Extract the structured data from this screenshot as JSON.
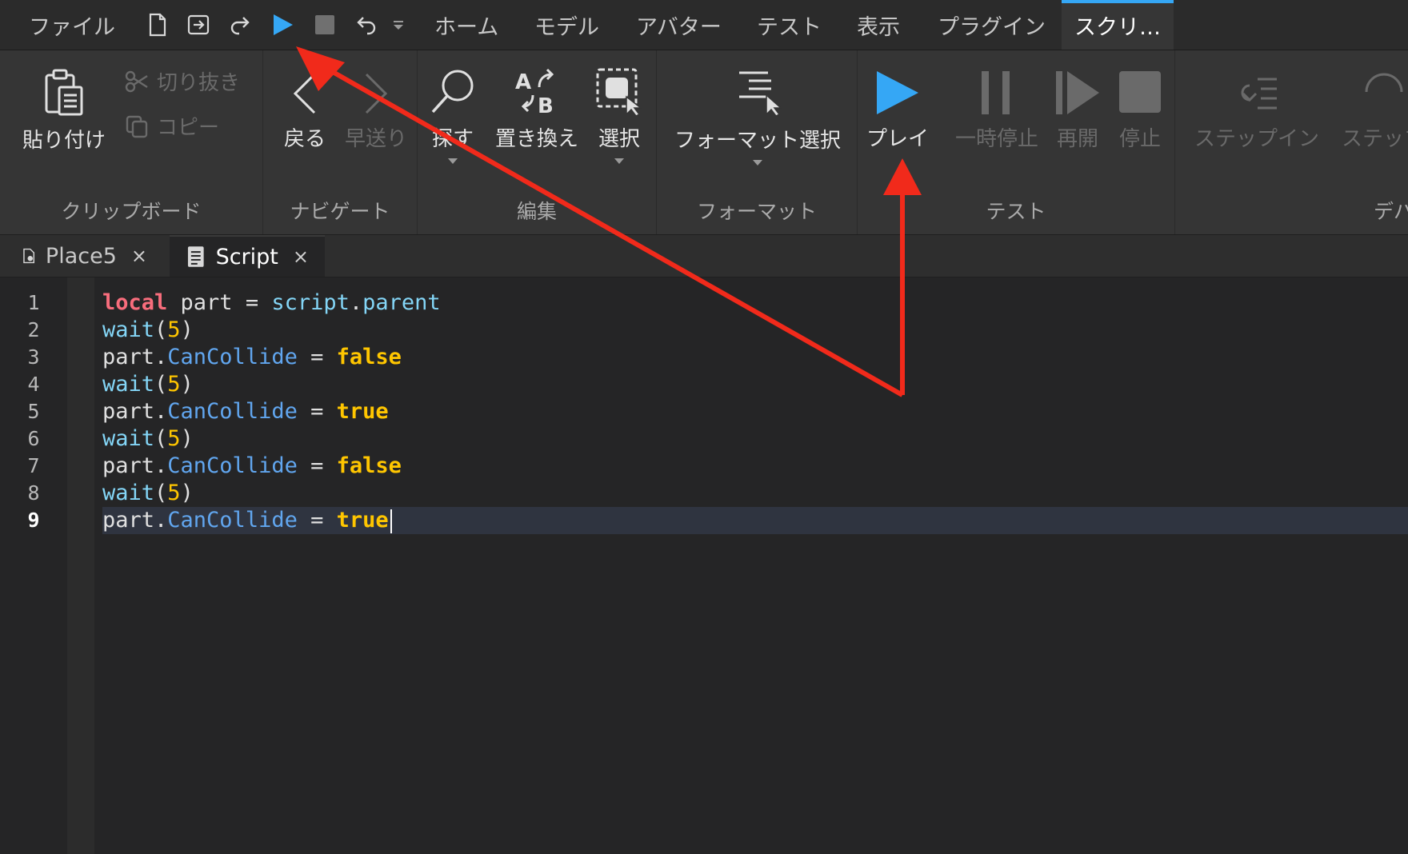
{
  "colors": {
    "accent": "#35a7f5",
    "annotation": "#f12a1b",
    "keyword": "#f86d7c",
    "builtin": "#84d6f7",
    "property": "#61a6ef",
    "literal": "#ffc600"
  },
  "menu": {
    "file": "ファイル",
    "tabs": [
      "ホーム",
      "モデル",
      "アバター",
      "テスト",
      "表示",
      "プラグイン",
      "スクリ…"
    ]
  },
  "quick_access": [
    "new-file-icon",
    "publish-icon",
    "redo-icon",
    "play-icon",
    "stop-icon",
    "undo-icon",
    "dropdown-icon"
  ],
  "ribbon": {
    "clipboard": {
      "label": "クリップボード",
      "paste": "貼り付け",
      "cut": "切り抜き",
      "copy": "コピー"
    },
    "navigate": {
      "label": "ナビゲート",
      "back": "戻る",
      "forward": "早送り"
    },
    "edit": {
      "label": "編集",
      "find": "探す",
      "replace": "置き換え",
      "select": "選択"
    },
    "format": {
      "label": "フォーマット",
      "format_selection": "フォーマット選択"
    },
    "test": {
      "label": "テスト",
      "play": "プレイ",
      "pause": "一時停止",
      "resume": "再開",
      "stop": "停止"
    },
    "debug": {
      "label": "デバ",
      "step_in": "ステップイン",
      "step_over": "ステップ"
    }
  },
  "doc_tabs": [
    {
      "label": "Place5",
      "close": "×"
    },
    {
      "label": "Script",
      "close": "×"
    }
  ],
  "editor": {
    "line_numbers": [
      "1",
      "2",
      "3",
      "4",
      "5",
      "6",
      "7",
      "8",
      "9"
    ],
    "lines": [
      [
        {
          "t": "local",
          "c": "local"
        },
        {
          "t": " part = ",
          "c": "ident"
        },
        {
          "t": "script",
          "c": "builtin"
        },
        {
          "t": ".",
          "c": "ident"
        },
        {
          "t": "parent",
          "c": "builtin"
        }
      ],
      [
        {
          "t": "wait",
          "c": "builtin"
        },
        {
          "t": "(",
          "c": "ident"
        },
        {
          "t": "5",
          "c": "num"
        },
        {
          "t": ")",
          "c": "ident"
        }
      ],
      [
        {
          "t": "part.",
          "c": "ident"
        },
        {
          "t": "CanCollide",
          "c": "prop"
        },
        {
          "t": " = ",
          "c": "ident"
        },
        {
          "t": "false",
          "c": "bool"
        }
      ],
      [
        {
          "t": "wait",
          "c": "builtin"
        },
        {
          "t": "(",
          "c": "ident"
        },
        {
          "t": "5",
          "c": "num"
        },
        {
          "t": ")",
          "c": "ident"
        }
      ],
      [
        {
          "t": "part.",
          "c": "ident"
        },
        {
          "t": "CanCollide",
          "c": "prop"
        },
        {
          "t": " = ",
          "c": "ident"
        },
        {
          "t": "true",
          "c": "bool"
        }
      ],
      [
        {
          "t": "wait",
          "c": "builtin"
        },
        {
          "t": "(",
          "c": "ident"
        },
        {
          "t": "5",
          "c": "num"
        },
        {
          "t": ")",
          "c": "ident"
        }
      ],
      [
        {
          "t": "part.",
          "c": "ident"
        },
        {
          "t": "CanCollide",
          "c": "prop"
        },
        {
          "t": " = ",
          "c": "ident"
        },
        {
          "t": "false",
          "c": "bool"
        }
      ],
      [
        {
          "t": "wait",
          "c": "builtin"
        },
        {
          "t": "(",
          "c": "ident"
        },
        {
          "t": "5",
          "c": "num"
        },
        {
          "t": ")",
          "c": "ident"
        }
      ],
      [
        {
          "t": "part.",
          "c": "ident"
        },
        {
          "t": "CanCollide",
          "c": "prop"
        },
        {
          "t": " = ",
          "c": "ident"
        },
        {
          "t": "true",
          "c": "bool"
        }
      ]
    ],
    "current_line": 9
  }
}
